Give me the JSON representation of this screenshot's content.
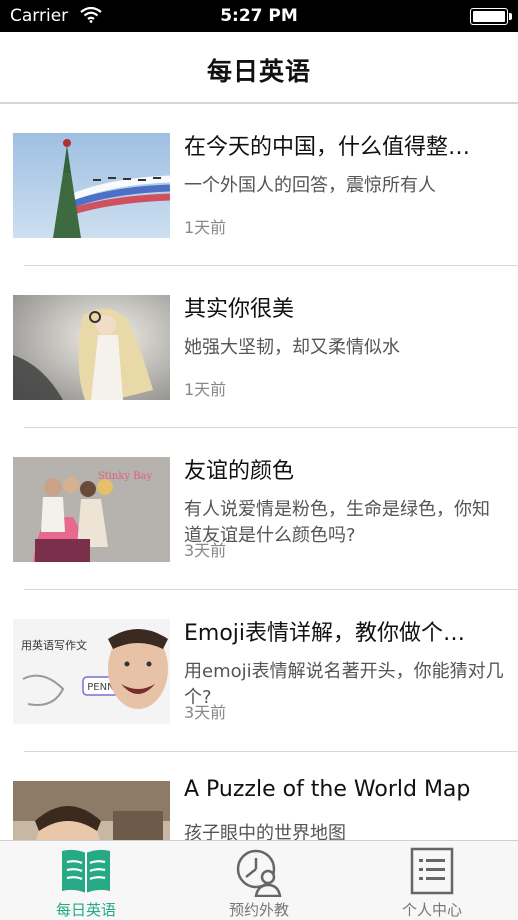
{
  "status": {
    "carrier": "Carrier",
    "time": "5:27 PM"
  },
  "header": {
    "title": "每日英语"
  },
  "articles": [
    {
      "title": "在今天的中国，什么值得整…",
      "desc": "一个外国人的回答，震惊所有人",
      "time": "1天前"
    },
    {
      "title": "其实你很美",
      "desc": "她强大坚韧，却又柔情似水",
      "time": "1天前"
    },
    {
      "title": "友谊的颜色",
      "desc": "有人说爱情是粉色，生命是绿色，你知道友谊是什么颜色吗?",
      "time": "3天前"
    },
    {
      "title": "Emoji表情详解，教你做个…",
      "desc": "用emoji表情解说名著开头，你能猜对几个?",
      "time": "3天前"
    },
    {
      "title": "A Puzzle of the World Map",
      "desc": "孩子眼中的世界地图",
      "time": ""
    }
  ],
  "thumb_text": {
    "book": "Stinky Bay",
    "penny": "PENNY",
    "pen": "用英语写作文"
  },
  "tabs": [
    {
      "label": "每日英语",
      "icon": "book-icon",
      "active": true
    },
    {
      "label": "预约外教",
      "icon": "clock-person-icon",
      "active": false
    },
    {
      "label": "个人中心",
      "icon": "list-document-icon",
      "active": false
    }
  ],
  "colors": {
    "accent": "#27a985",
    "inactive": "#777777"
  }
}
